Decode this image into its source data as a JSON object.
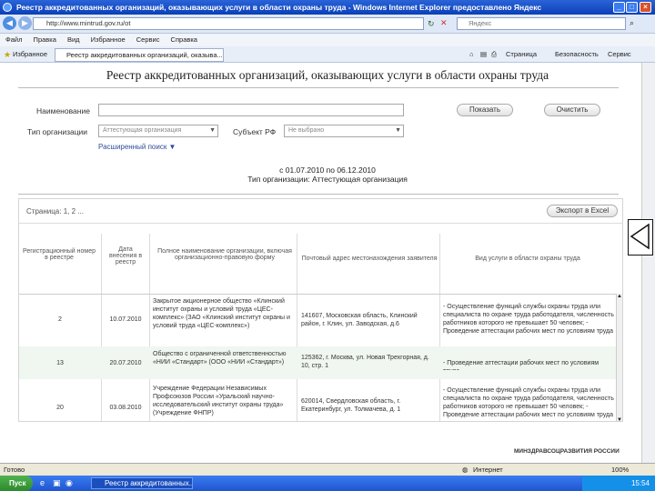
{
  "window": {
    "title": "Реестр аккредитованных организаций, оказывающих услуги в области охраны труда - Windows Internet Explorer предоставлено Яндекс"
  },
  "address": {
    "url": "http://www.mintrud.gov.ru/ot",
    "search_label": "Яндекс"
  },
  "menu": [
    "Файл",
    "Правка",
    "Вид",
    "Избранное",
    "Сервис",
    "Справка"
  ],
  "favorites": {
    "label": "Избранное",
    "tab": "Реестр аккредитованных организаций, оказыва..."
  },
  "command_bar": {
    "page": "Страница",
    "security": "Безопасность",
    "service": "Сервис"
  },
  "page": {
    "title": "Реестр аккредитованных организаций, оказывающих услуги в области охраны труда",
    "name_label": "Наименование",
    "orgtype_label": "Тип организации",
    "orgtype_value": "Аттестующая организация",
    "subject_label": "Субъект РФ",
    "subject_value": "Не выбрано",
    "advanced_link": "Расширенный поиск ▼",
    "search_btn": "Показать",
    "clear_btn": "Очистить",
    "period": "с 01.07.2010 по 06.12.2010",
    "orgtype_line": "Тип организации: Аттестующая организация",
    "pages": "Страница: 1, 2 ...",
    "excel_btn": "Экспорт в Excel"
  },
  "table": {
    "headers": [
      "Регистрационный номер в реестре",
      "Дата внесения в реестр",
      "Полное наименование организации, включая организационно-правовую форму",
      "Почтовый адрес местонахождения заявителя",
      "Вид услуги в области охраны труда"
    ],
    "rows": [
      {
        "num": "2",
        "date": "10.07.2010",
        "name": "Закрытое акционерное общество «Клинский институт охраны и условий труда «ЦЕС-комплекс» (ЗАО «Клинский институт охраны и условий труда «ЦЕС-комплекс»)",
        "address": "141607, Московская область, Клинский район, г. Клин, ул. Заводская, д.6",
        "service": "- Осуществление функций службы охраны труда или специалиста по охране труда работодателя, численность работников которого не превышает 50 человек; - Проведение аттестации рабочих мест по условиям труда"
      },
      {
        "num": "13",
        "date": "20.07.2010",
        "name": "Общество с ограниченной ответственностью «НИИ «Стандарт» (ООО «НИИ «Стандарт»)",
        "address": "125362, г. Москва, ул. Новая Трехгорная, д. 10, стр. 1",
        "service": "- Проведение аттестации рабочих мест по условиям труда"
      },
      {
        "num": "20",
        "date": "03.08.2010",
        "name": "Учреждение Федерации Независимых Профсоюзов России «Уральский научно-исследовательский институт охраны труда» (Учреждение ФНПР)",
        "address": "620014, Свердловская область, г. Екатеринбург, ул. Толмачева, д. 1",
        "service": "- Осуществление функций службы охраны труда или специалиста по охране труда работодателя, численность работников которого не превышает 50 человек; - Проведение аттестации рабочих мест по условиям труда"
      }
    ]
  },
  "footer": {
    "logo": "МИНЗДРАВСОЦРАЗВИТИЯ РОССИИ"
  },
  "status": {
    "left": "Готово",
    "zone": "Интернет",
    "zoom": "100%"
  },
  "taskbar": {
    "start": "Пуск",
    "item": "Реестр аккредитованных...",
    "clock": "15:54"
  }
}
